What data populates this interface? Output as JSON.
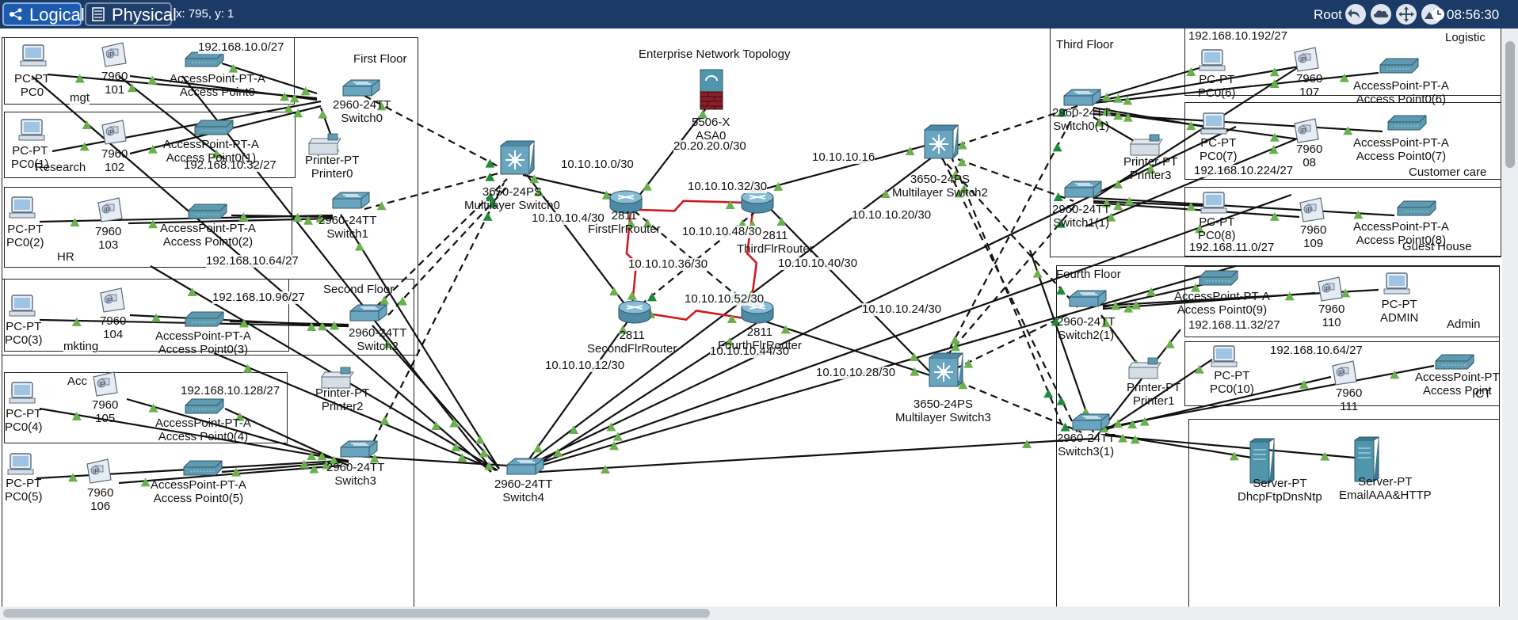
{
  "toolbar": {
    "logical_label": "Logical",
    "physical_label": "Physical",
    "coords": "x: 795, y: 1",
    "root_label": "Root",
    "clock": "08:56:30",
    "icons": [
      "back-icon",
      "cloud-icon",
      "move-icon",
      "landscape-icon",
      "clock-icon"
    ]
  },
  "canvas": {
    "title": "Enterprise Network Topology",
    "areas": [
      {
        "label": "First Floor"
      },
      {
        "label": "Second Floor"
      },
      {
        "label": "Third Floor"
      },
      {
        "label": "Fourth Floor"
      }
    ],
    "department_labels": [
      "mgt",
      "Research",
      "HR",
      "mkting",
      "Acc",
      "Logistic",
      "Customer care",
      "Guest House",
      "Admin",
      "ICT"
    ],
    "subnet_labels": [
      "192.168.10.0/27",
      "192.168.10.32/27",
      "192.168.10.64/27",
      "192.168.10.96/27",
      "192.168.10.128/27",
      "192.168.10.192/27",
      "192.168.10.224/27",
      "192.168.11.0/27",
      "192.168.11.32/27",
      "192.168.10.64/27"
    ],
    "link_labels": [
      "10.10.10.0/30",
      "20.20.20.0/30",
      "10.10.10.32/30",
      "10.10.10.16",
      "10.10.10.4/30",
      "10.10.10.48/30",
      "10.10.10.20/30",
      "10.10.10.36/30",
      "10.10.10.40/30",
      "10.10.10.52/30",
      "10.10.10.24/30",
      "10.10.10.44/30",
      "10.10.10.12/30",
      "10.10.10.28/30"
    ],
    "devices": [
      {
        "model": "PC-PT",
        "name": "PC0"
      },
      {
        "model": "7960",
        "name": "101"
      },
      {
        "model": "AccessPoint-PT-A",
        "name": "Access Point0"
      },
      {
        "model": "2960-24TT",
        "name": "Switch0"
      },
      {
        "model": "Printer-PT",
        "name": "Printer0"
      },
      {
        "model": "PC-PT",
        "name": "PC0(1)"
      },
      {
        "model": "7960",
        "name": "102"
      },
      {
        "model": "AccessPoint-PT-A",
        "name": "Access Point0(1)"
      },
      {
        "model": "PC-PT",
        "name": "PC0(2)"
      },
      {
        "model": "7960",
        "name": "103"
      },
      {
        "model": "AccessPoint-PT-A",
        "name": "Access Point0(2)"
      },
      {
        "model": "2960-24TT",
        "name": "Switch1"
      },
      {
        "model": "PC-PT",
        "name": "PC0(3)"
      },
      {
        "model": "7960",
        "name": "104"
      },
      {
        "model": "AccessPoint-PT-A",
        "name": "Access Point0(3)"
      },
      {
        "model": "2960-24TT",
        "name": "Switch2"
      },
      {
        "model": "Printer-PT",
        "name": "Printer2"
      },
      {
        "model": "PC-PT",
        "name": "PC0(4)"
      },
      {
        "model": "7960",
        "name": "105"
      },
      {
        "model": "AccessPoint-PT-A",
        "name": "Access Point0(4)"
      },
      {
        "model": "PC-PT",
        "name": "PC0(5)"
      },
      {
        "model": "7960",
        "name": "106"
      },
      {
        "model": "AccessPoint-PT-A",
        "name": "Access Point0(5)"
      },
      {
        "model": "2960-24TT",
        "name": "Switch3"
      },
      {
        "model": "3650-24PS",
        "name": "Multilayer Switch0"
      },
      {
        "model": "5506-X",
        "name": "ASA0"
      },
      {
        "model": "2811",
        "name": "FirstFlrRouter"
      },
      {
        "model": "2811",
        "name": "ThirdFlrRouter"
      },
      {
        "model": "2811",
        "name": "SecondFlrRouter"
      },
      {
        "model": "2811",
        "name": "FourthFlrRouter"
      },
      {
        "model": "2960-24TT",
        "name": "Switch4"
      },
      {
        "model": "3650-24PS",
        "name": "Multilayer Switch2"
      },
      {
        "model": "3650-24PS",
        "name": "Multilayer Switch3"
      },
      {
        "model": "2960-24TT",
        "name": "Switch0(1)"
      },
      {
        "model": "PC-PT",
        "name": "PC0(6)"
      },
      {
        "model": "7960",
        "name": "107"
      },
      {
        "model": "AccessPoint-PT-A",
        "name": "Access Point0(6)"
      },
      {
        "model": "Printer-PT",
        "name": "Printer3"
      },
      {
        "model": "PC-PT",
        "name": "PC0(7)"
      },
      {
        "model": "7960",
        "name": "08"
      },
      {
        "model": "AccessPoint-PT-A",
        "name": "Access Point0(7)"
      },
      {
        "model": "2960-24TT",
        "name": "Switch1(1)"
      },
      {
        "model": "PC-PT",
        "name": "PC0(8)"
      },
      {
        "model": "7960",
        "name": "109"
      },
      {
        "model": "AccessPoint-PT-A",
        "name": "Access Point0(8)"
      },
      {
        "model": "2960-24TT",
        "name": "Switch2(1)"
      },
      {
        "model": "AccessPoint-PT-A",
        "name": "Access Point0(9)"
      },
      {
        "model": "7960",
        "name": "110"
      },
      {
        "model": "PC-PT",
        "name": "ADMIN"
      },
      {
        "model": "Printer-PT",
        "name": "Printer1"
      },
      {
        "model": "PC-PT",
        "name": "PC0(10)"
      },
      {
        "model": "7960",
        "name": "111"
      },
      {
        "model": "AccessPoint-PT",
        "name": "Access Point"
      },
      {
        "model": "2960-24TT",
        "name": "Switch3(1)"
      },
      {
        "model": "Server-PT",
        "name": "DhcpFtpDnsNtp"
      },
      {
        "model": "Server-PT",
        "name": "EmailAAA&HTTP"
      }
    ]
  }
}
